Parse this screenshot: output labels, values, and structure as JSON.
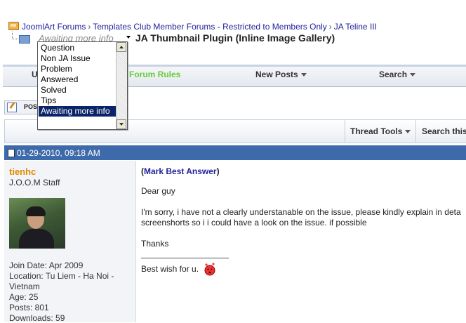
{
  "breadcrumb": {
    "items": [
      "JoomlArt Forums",
      "Templates Club Member Forums - Restricted to Members Only",
      "JA Teline III"
    ],
    "separator": "›"
  },
  "thread": {
    "prefix_current": "Awaiting more info",
    "title": "JA Thumbnail Plugin (Inline Image Gallery)"
  },
  "prefix_dropdown": {
    "options": [
      "Question",
      "Non JA Issue",
      "Problem",
      "Answered",
      "Solved",
      "Tips",
      "Awaiting more info"
    ],
    "selected_index": 6
  },
  "navbar": {
    "items": [
      {
        "label": "U",
        "has_arrow": false
      },
      {
        "label": "Forum Rules",
        "has_arrow": false
      },
      {
        "label": "New Posts",
        "has_arrow": true
      },
      {
        "label": "Search",
        "has_arrow": true
      }
    ]
  },
  "reply_button": {
    "label": "POS"
  },
  "thread_tools": {
    "tools_label": "Thread Tools",
    "search_label": "Search this"
  },
  "post": {
    "date": "01-29-2010, 09:18 AM",
    "user": {
      "name": "tienhc",
      "title": "J.O.O.M Staff",
      "join_date": "Join Date: Apr 2009",
      "location_line1": "Location: Tu Liem - Ha Noi -",
      "location_line2": "Vietnam",
      "age": "Age: 25",
      "posts": "Posts: 801",
      "downloads": "Downloads: 59"
    },
    "mark_best": {
      "open": "(",
      "label": "Mark Best Answer",
      "close": ")"
    },
    "body": {
      "greeting": "Dear guy",
      "line1": "I'm sorry, i have not a clearly understanable on the issue, please kindly explain in deta",
      "line2": "screenshorts so i i could have a look on the issue. if possible",
      "thanks": "Thanks",
      "signature": "Best wish for u."
    }
  },
  "colors": {
    "post_header": "#3d6aaa",
    "username": "#e08a00",
    "forum_rules": "#66cc33",
    "link": "#22229c"
  }
}
